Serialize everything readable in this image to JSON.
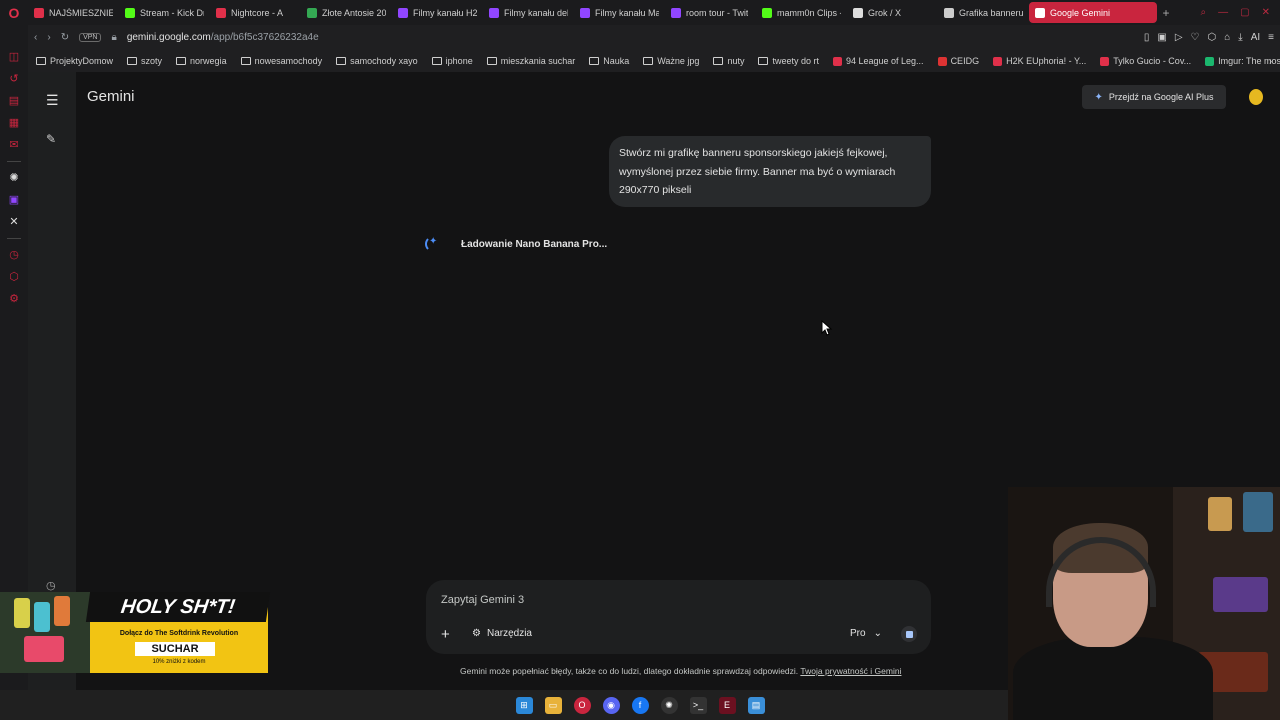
{
  "browser": {
    "tabs": [
      {
        "label": "NAJŚMIESZNIEJ",
        "color": "#e0304a"
      },
      {
        "label": "Stream - Kick Dr",
        "color": "#53fc18"
      },
      {
        "label": "Nightcore - A",
        "color": "#e0304a"
      },
      {
        "label": "Złote Antosie 20",
        "color": "#34a853"
      },
      {
        "label": "Filmy kanału H2",
        "color": "#9146ff"
      },
      {
        "label": "Filmy kanału del",
        "color": "#9146ff"
      },
      {
        "label": "Filmy kanału Ma",
        "color": "#9146ff"
      },
      {
        "label": "room tour - Twit",
        "color": "#9146ff"
      },
      {
        "label": "mamm0n Clips -",
        "color": "#53fc18"
      },
      {
        "label": "Grok / X",
        "color": "#dddddd"
      },
      {
        "label": "Grafika banneru",
        "color": "#cccccc"
      },
      {
        "label": "Google Gemini",
        "color": "#ffffff"
      }
    ],
    "vpn_label": "VPN",
    "url_host": "gemini.google.com",
    "url_path": "/app/b6f5c37626232a4e",
    "ai_label": "AI",
    "bookmarks": [
      {
        "label": "ProjektyDomow",
        "kind": "folder"
      },
      {
        "label": "szoty",
        "kind": "folder"
      },
      {
        "label": "norwegia",
        "kind": "folder"
      },
      {
        "label": "nowesamochody",
        "kind": "folder"
      },
      {
        "label": "samochody xayo",
        "kind": "folder"
      },
      {
        "label": "iphone",
        "kind": "folder"
      },
      {
        "label": "mieszkania suchar",
        "kind": "folder"
      },
      {
        "label": "Nauka",
        "kind": "folder"
      },
      {
        "label": "Ważne jpg",
        "kind": "folder"
      },
      {
        "label": "nuty",
        "kind": "folder"
      },
      {
        "label": "tweety do rt",
        "kind": "folder"
      },
      {
        "label": "94 League of Leg...",
        "kind": "site",
        "color": "#e0304a"
      },
      {
        "label": "CEIDG",
        "kind": "site",
        "color": "#d33"
      },
      {
        "label": "H2K EUphoria! - Y...",
        "kind": "site",
        "color": "#e0304a"
      },
      {
        "label": "Tylko Gucio - Cov...",
        "kind": "site",
        "color": "#e0304a"
      },
      {
        "label": "Imgur: The most a...",
        "kind": "site",
        "color": "#1bb76e"
      }
    ]
  },
  "gemini": {
    "title": "Gemini",
    "upgrade_label": "Przejdź na Google AI Plus",
    "user_message": "Stwórz mi grafikę banneru sponsorskiego jakiejś fejkowej, wymyślonej przez siebie firmy. Banner ma być o wymiarach 290x770 pikseli",
    "loading_text": "Ładowanie Nano Banana Pro...",
    "input_placeholder": "Zapytaj Gemini 3",
    "tools_label": "Narzędzia",
    "model_label": "Pro",
    "disclaimer": "Gemini może popełniać błędy, także co do ludzi, dlatego dokładnie sprawdzaj odpowiedzi.",
    "privacy_link": "Twoja prywatność i Gemini"
  },
  "promo": {
    "headline": "HOLY SH*T!",
    "line1": "Dołącz do The Softdrink Revolution",
    "code": "SUCHAR",
    "line2": "10% zniżki z kodem"
  },
  "colors": {
    "accent_red": "#c9253e",
    "gemini_blue": "#4c8df6"
  }
}
